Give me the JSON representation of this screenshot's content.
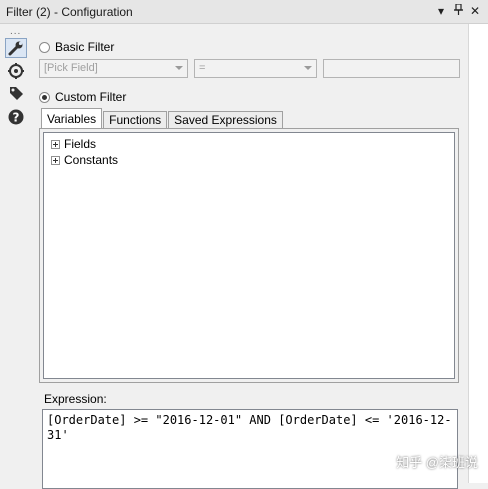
{
  "window": {
    "title": "Filter (2) - Configuration",
    "buttons": {
      "dropdown": "▾",
      "pin": "📌",
      "close": "✕"
    }
  },
  "sidebar": {
    "grip": "...",
    "items": [
      {
        "name": "configuration",
        "icon": "wrench-icon",
        "active": true
      },
      {
        "name": "layout",
        "icon": "target-icon",
        "active": false
      },
      {
        "name": "annotation",
        "icon": "tag-icon",
        "active": false
      },
      {
        "name": "help",
        "icon": "question-icon",
        "active": false
      }
    ]
  },
  "basic_filter": {
    "label": "Basic Filter",
    "selected": false,
    "field_placeholder": "[Pick Field]",
    "operator_value": "=",
    "value_field": ""
  },
  "custom_filter": {
    "label": "Custom Filter",
    "selected": true
  },
  "tabs": [
    {
      "label": "Variables",
      "active": true
    },
    {
      "label": "Functions",
      "active": false
    },
    {
      "label": "Saved Expressions",
      "active": false
    }
  ],
  "variables_tree": [
    {
      "label": "Fields"
    },
    {
      "label": "Constants"
    }
  ],
  "expression": {
    "label": "Expression:",
    "value": "[OrderDate] >= \"2016-12-01\" AND [OrderDate] <= '2016-12-31'"
  },
  "watermark": "知乎 @柒班说"
}
